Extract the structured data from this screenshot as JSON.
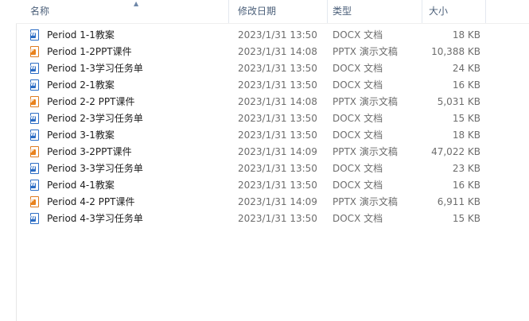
{
  "columns": {
    "name": "名称",
    "date": "修改日期",
    "type": "类型",
    "size": "大小"
  },
  "colors": {
    "header_text": "#4c607a",
    "docx_icon": "#2b6cc4",
    "pptx_icon": "#e8821e"
  },
  "files": [
    {
      "name": "Period 1-1教案",
      "date": "2023/1/31 13:50",
      "type": "DOCX 文档",
      "size": "18 KB",
      "icon": "word-doc-icon"
    },
    {
      "name": "Period 1-2PPT课件",
      "date": "2023/1/31 14:08",
      "type": "PPTX 演示文稿",
      "size": "10,388 KB",
      "icon": "powerpoint-icon"
    },
    {
      "name": "Period 1-3学习任务单",
      "date": "2023/1/31 13:50",
      "type": "DOCX 文档",
      "size": "24 KB",
      "icon": "word-doc-icon"
    },
    {
      "name": "Period 2-1教案",
      "date": "2023/1/31 13:50",
      "type": "DOCX 文档",
      "size": "16 KB",
      "icon": "word-doc-icon"
    },
    {
      "name": "Period 2-2 PPT课件",
      "date": "2023/1/31 14:08",
      "type": "PPTX 演示文稿",
      "size": "5,031 KB",
      "icon": "powerpoint-icon"
    },
    {
      "name": "Period 2-3学习任务单",
      "date": "2023/1/31 13:50",
      "type": "DOCX 文档",
      "size": "15 KB",
      "icon": "word-doc-icon"
    },
    {
      "name": "Period 3-1教案",
      "date": "2023/1/31 13:50",
      "type": "DOCX 文档",
      "size": "18 KB",
      "icon": "word-doc-icon"
    },
    {
      "name": "Period 3-2PPT课件",
      "date": "2023/1/31 14:09",
      "type": "PPTX 演示文稿",
      "size": "47,022 KB",
      "icon": "powerpoint-icon"
    },
    {
      "name": "Period 3-3学习任务单",
      "date": "2023/1/31 13:50",
      "type": "DOCX 文档",
      "size": "23 KB",
      "icon": "word-doc-icon"
    },
    {
      "name": "Period 4-1教案",
      "date": "2023/1/31 13:50",
      "type": "DOCX 文档",
      "size": "16 KB",
      "icon": "word-doc-icon"
    },
    {
      "name": "Period 4-2 PPT课件",
      "date": "2023/1/31 14:09",
      "type": "PPTX 演示文稿",
      "size": "6,911 KB",
      "icon": "powerpoint-icon"
    },
    {
      "name": "Period 4-3学习任务单",
      "date": "2023/1/31 13:50",
      "type": "DOCX 文档",
      "size": "15 KB",
      "icon": "word-doc-icon"
    }
  ]
}
